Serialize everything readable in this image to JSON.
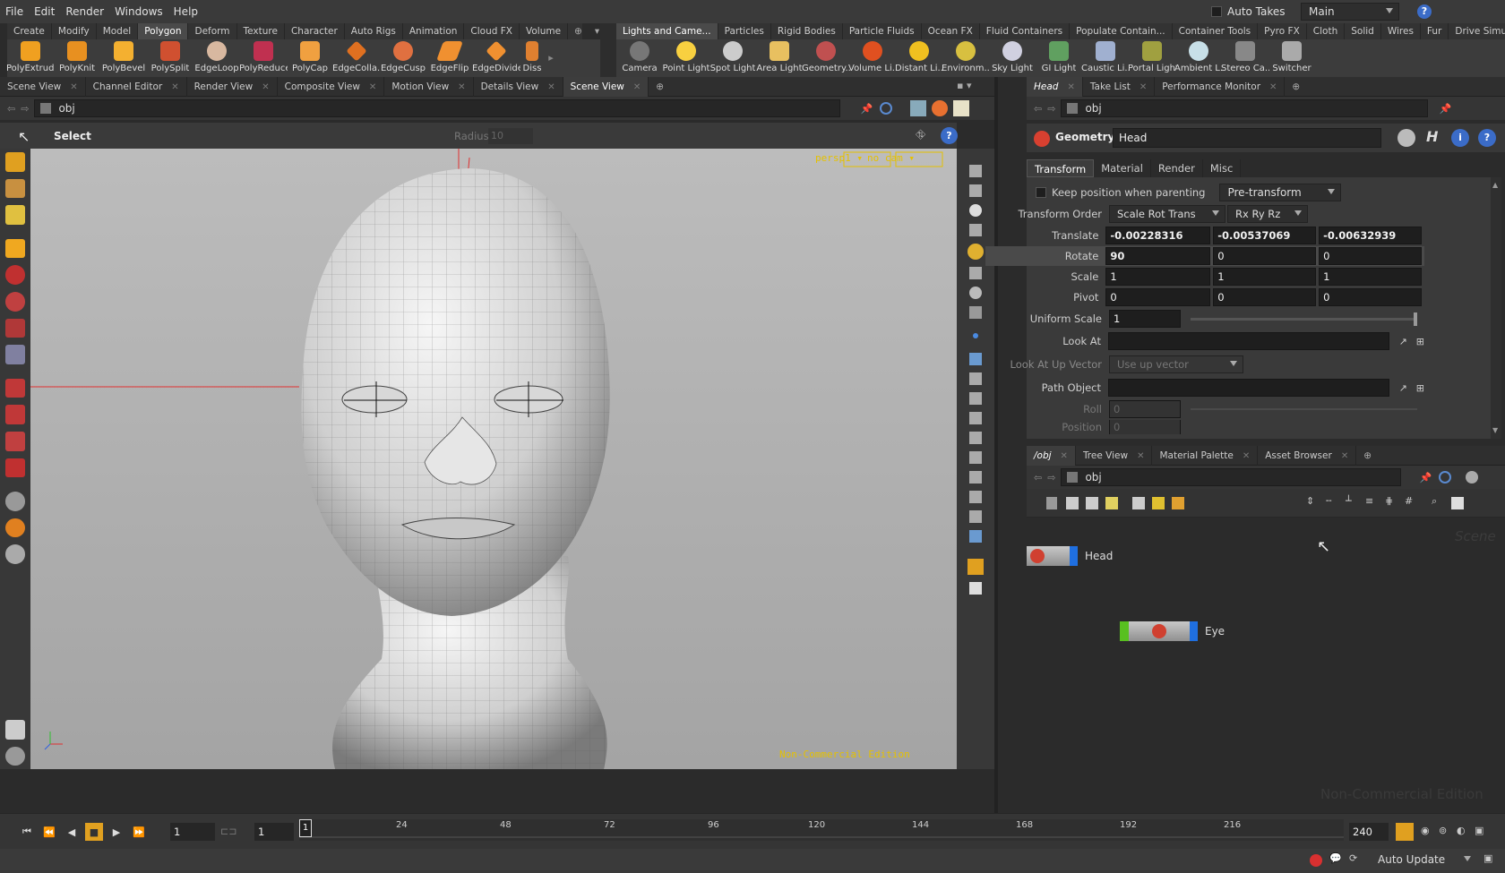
{
  "menubar": {
    "items": [
      "File",
      "Edit",
      "Render",
      "Windows",
      "Help"
    ],
    "auto_takes": "Auto Takes",
    "desktop": "Main",
    "help_icon": "?"
  },
  "shelf_left": {
    "tabs": [
      "Create",
      "Modify",
      "Model",
      "Polygon",
      "Deform",
      "Texture",
      "Character",
      "Auto Rigs",
      "Animation",
      "Cloud FX",
      "Volume"
    ],
    "active_tab": "Polygon",
    "tools": [
      "PolyExtrude",
      "PolyKnit",
      "PolyBevel",
      "PolySplit",
      "EdgeLoop",
      "PolyReduce",
      "PolyCap",
      "EdgeColla...",
      "EdgeCusp",
      "EdgeFlip",
      "EdgeDivide",
      "Diss"
    ]
  },
  "shelf_right": {
    "tabs": [
      "Lights and Came...",
      "Particles",
      "Rigid Bodies",
      "Particle Fluids",
      "Ocean FX",
      "Fluid Containers",
      "Populate Contain...",
      "Container Tools",
      "Pyro FX",
      "Cloth",
      "Solid",
      "Wires",
      "Fur",
      "Drive Simulation"
    ],
    "tools": [
      "Camera",
      "Point Light",
      "Spot Light",
      "Area Light",
      "Geometry...",
      "Volume Li...",
      "Distant Li...",
      "Environm...",
      "Sky Light",
      "GI Light",
      "Caustic Li...",
      "Portal Light",
      "Ambient L...",
      "Stereo Ca...",
      "Switcher"
    ]
  },
  "viewer": {
    "tabs": [
      "Scene View",
      "Channel Editor",
      "Render View",
      "Composite View",
      "Motion View",
      "Details View",
      "Scene View"
    ],
    "active_tab_index": 6,
    "path": "obj",
    "tool_label": "Select",
    "radius_label": "Radius",
    "radius_value": "10",
    "camera_menu": "persp1",
    "cam_menu": "no cam",
    "watermark": "Non-Commercial Edition"
  },
  "params": {
    "tabs": [
      "Head",
      "Take List",
      "Performance Monitor"
    ],
    "path": "obj",
    "node_type": "Geometry",
    "node_name": "Head",
    "subtabs": [
      "Transform",
      "Material",
      "Render",
      "Misc"
    ],
    "active_subtab": "Transform",
    "keep_position_label": "Keep position when parenting",
    "pretransform_label": "Pre-transform",
    "transform_order_label": "Transform Order",
    "transform_order_value": "Scale Rot Trans",
    "rot_order_value": "Rx Ry Rz",
    "translate_label": "Translate",
    "translate": [
      "-0.00228316",
      "-0.00537069",
      "-0.00632939"
    ],
    "rotate_label": "Rotate",
    "rotate": [
      "90",
      "0",
      "0"
    ],
    "scale_label": "Scale",
    "scale": [
      "1",
      "1",
      "1"
    ],
    "pivot_label": "Pivot",
    "pivot": [
      "0",
      "0",
      "0"
    ],
    "uniform_scale_label": "Uniform Scale",
    "uniform_scale": "1",
    "look_at_label": "Look At",
    "look_at_up_label": "Look At Up Vector",
    "look_at_up_value": "Use up vector",
    "path_object_label": "Path Object",
    "roll_label": "Roll",
    "roll_value": "0",
    "position_label": "Position",
    "position_value": "0"
  },
  "network": {
    "tabs": [
      "/obj",
      "Tree View",
      "Material Palette",
      "Asset Browser"
    ],
    "path": "obj",
    "context_label": "Scene",
    "nodes": [
      "Head",
      "Eye"
    ],
    "watermark": "Non-Commercial Edition"
  },
  "timeline": {
    "start_frame": "1",
    "current_frame": "1",
    "playhead": "1",
    "end_frame": "240",
    "ticks": [
      "24",
      "48",
      "72",
      "96",
      "120",
      "144",
      "168",
      "192",
      "216"
    ],
    "auto_update": "Auto Update"
  },
  "colors": {
    "accent_yellow": "#e5c100",
    "axis_red": "#e03030",
    "node_blue": "#1f6fe0",
    "node_green": "#58c020"
  }
}
